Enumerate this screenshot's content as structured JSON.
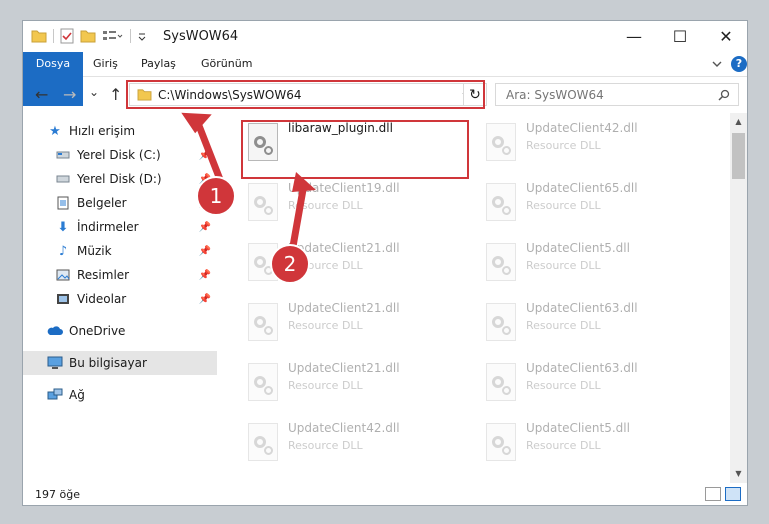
{
  "window": {
    "title": "SysWOW64",
    "controls": {
      "minimize": "—",
      "maximize": "☐",
      "close": "✕"
    }
  },
  "ribbon": {
    "tabs": [
      "Dosya",
      "Giriş",
      "Paylaş",
      "Görünüm"
    ],
    "collapse_icon": "chevron-down-icon",
    "help_icon": "?"
  },
  "navigation": {
    "back": "←",
    "forward": "→",
    "recent": "⌄",
    "up": "↑",
    "address": "C:\\Windows\\SysWOW64",
    "refresh": "↻",
    "search_placeholder": "Ara: SysWOW64"
  },
  "sidebar": {
    "items": [
      {
        "label": "Hızlı erişim",
        "icon": "star-icon",
        "pinned": false
      },
      {
        "label": "Yerel Disk (C:)",
        "icon": "drive-icon",
        "pinned": true
      },
      {
        "label": "Yerel Disk (D:)",
        "icon": "drive-icon",
        "pinned": true
      },
      {
        "label": "Belgeler",
        "icon": "document-icon",
        "pinned": true
      },
      {
        "label": "İndirmeler",
        "icon": "download-icon",
        "pinned": true
      },
      {
        "label": "Müzik",
        "icon": "music-icon",
        "pinned": true
      },
      {
        "label": "Resimler",
        "icon": "pictures-icon",
        "pinned": true
      },
      {
        "label": "Videolar",
        "icon": "video-icon",
        "pinned": true
      },
      {
        "label": "OneDrive",
        "icon": "cloud-icon",
        "pinned": false
      },
      {
        "label": "Bu bilgisayar",
        "icon": "computer-icon",
        "pinned": false,
        "selected": true
      },
      {
        "label": "Ağ",
        "icon": "network-icon",
        "pinned": false
      }
    ]
  },
  "files": [
    {
      "name": "libaraw_plugin.dll",
      "type": "",
      "highlighted": true
    },
    {
      "name": "UpdateClient42.dll",
      "type": "Resource DLL"
    },
    {
      "name": "UpdateClient19.dll",
      "type": "Resource DLL"
    },
    {
      "name": "UpdateClient65.dll",
      "type": "Resource DLL"
    },
    {
      "name": "UpdateClient21.dll",
      "type": "Resource DLL"
    },
    {
      "name": "UpdateClient5.dll",
      "type": "Resource DLL"
    },
    {
      "name": "UpdateClient21.dll",
      "type": "Resource DLL"
    },
    {
      "name": "UpdateClient63.dll",
      "type": "Resource DLL"
    },
    {
      "name": "UpdateClient21.dll",
      "type": "Resource DLL"
    },
    {
      "name": "UpdateClient63.dll",
      "type": "Resource DLL"
    },
    {
      "name": "UpdateClient42.dll",
      "type": "Resource DLL"
    },
    {
      "name": "UpdateClient5.dll",
      "type": "Resource DLL"
    }
  ],
  "annotations": {
    "step1": "1",
    "step2": "2"
  },
  "status": {
    "count": "197 öğe"
  },
  "colors": {
    "accent": "#1c6cc4",
    "highlight": "#d0363a"
  }
}
